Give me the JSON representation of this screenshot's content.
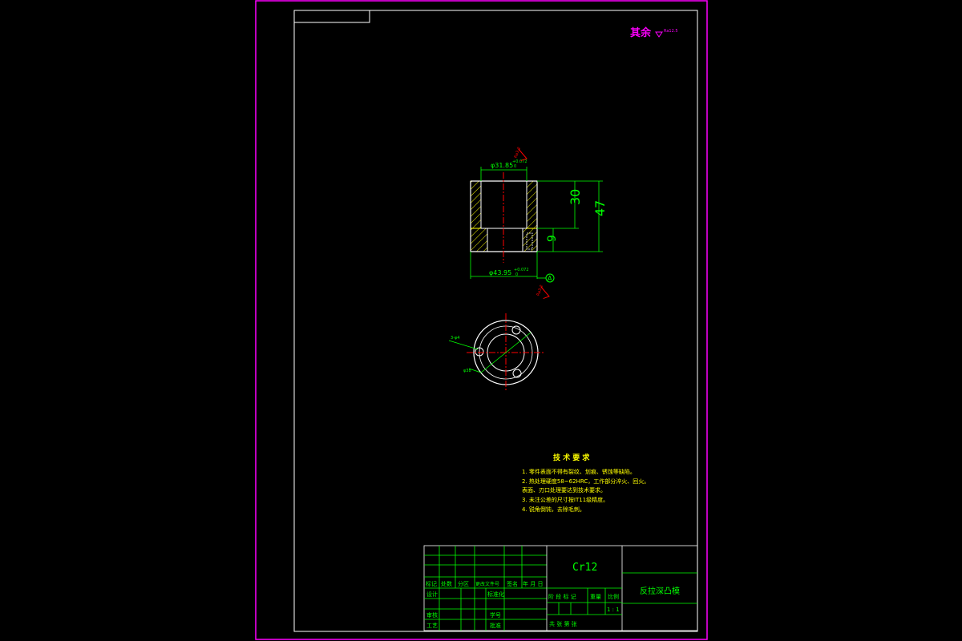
{
  "roughness_note": {
    "text": "其余",
    "symbol_value": "Ra12.5",
    "color": "#ff00ff"
  },
  "dimensions": {
    "inner_dia": "φ31.85",
    "inner_dia_tol": "+0.072",
    "inner_dia_tol_low": "0",
    "outer_dia": "φ43.95",
    "outer_dia_tol": "+0.072",
    "outer_dia_tol_low": "0",
    "height_upper": "30",
    "height_total": "47",
    "height_lower": "9",
    "datum": "A",
    "roughness_top": "Ra3.2",
    "roughness_bottom": "Ra3.2",
    "hole_label": "3-φ4",
    "pcd_label": "φ38"
  },
  "tech_requirements": {
    "title": "技 术 要 求",
    "items": [
      "1. 零件表面不得有裂纹、划痕、锈蚀等缺陷。",
      "2. 热处理硬度58~62HRC，工作部分淬火、回火。",
      "   表面、刃口处理要达到技术要求。",
      "3. 未注公差的尺寸按IT11级精度。",
      "4. 锐角倒钝，去除毛刺。"
    ]
  },
  "title_block": {
    "material": "Cr12",
    "part_name": "反拉深凸模",
    "row_header": [
      "标记",
      "处数",
      "分区",
      "更改文件号",
      "签名",
      "年 月 日"
    ],
    "designer": "设计",
    "standardize": "标准化",
    "reviewer": "审核",
    "process": "工艺",
    "student_no": "学号",
    "approve": "批准",
    "stage_label": "阶 段 标 记",
    "weight_label": "重量",
    "scale_label": "比例",
    "scale_value": "1 : 1",
    "sheets": "共   张 第   张"
  },
  "colors": {
    "frame": "#ff00ff",
    "border": "#ffffff",
    "dimension": "#00ff00",
    "centerline": "#ff0000",
    "hatch": "#ffff00",
    "text": "#ffff00",
    "title_text": "#00ff00"
  }
}
